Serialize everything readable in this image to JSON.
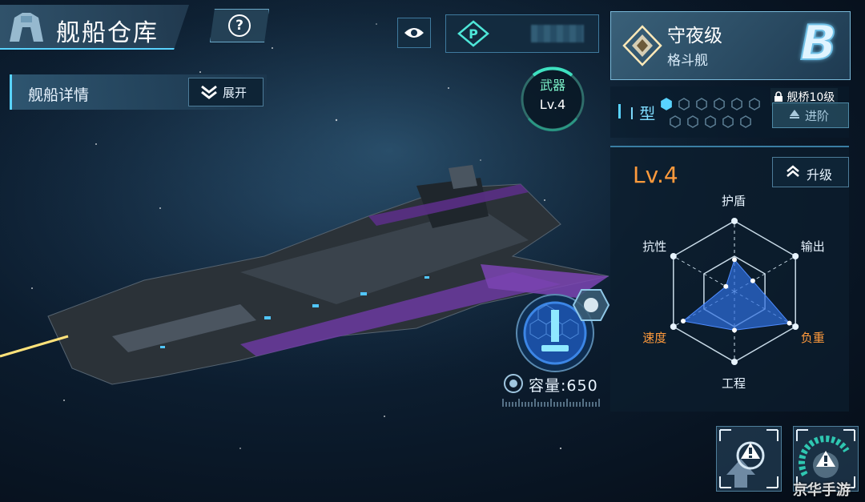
{
  "header": {
    "title": "舰船仓库",
    "title_icon": "hangar-emblem-icon",
    "help_icon": "help-icon"
  },
  "detail_bar": {
    "label": "舰船详情",
    "expand_label": "展开"
  },
  "top_controls": {
    "eye_icon": "eye-icon",
    "currency_icon": "p-currency-icon",
    "currency_value_obscured": true
  },
  "ship": {
    "class_name": "守夜级",
    "ship_type": "格斗舰",
    "grade": "B"
  },
  "weapon": {
    "label": "武器",
    "level": "Lv.4"
  },
  "type_row": {
    "label": "I 型",
    "slots_filled": 1,
    "slots_total": 11,
    "bridge_requirement": "舰桥10级",
    "advance_label": "进阶"
  },
  "stats": {
    "level": "Lv.4",
    "upgrade_label": "升级",
    "axes": [
      "护盾",
      "输出",
      "负重",
      "工程",
      "速度",
      "抗性"
    ],
    "highlighted_axes": [
      "负重",
      "速度"
    ],
    "values": [
      0.45,
      0.3,
      0.9,
      0.55,
      0.84,
      0.14
    ],
    "accent_color": "#ff9a3c",
    "radar_color": "#2e6fe0"
  },
  "capacity": {
    "text": "容量:650"
  },
  "actions": {
    "left_icon": "upgrade-warning-icon",
    "right_icon": "repair-warning-icon"
  },
  "watermark": "京华手游"
}
